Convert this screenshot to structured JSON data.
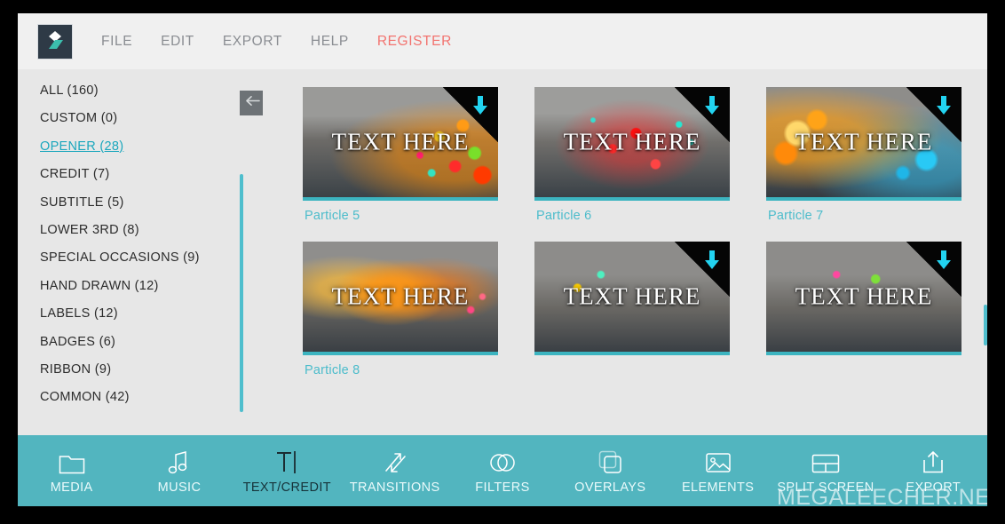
{
  "app": {
    "logo_icon": "filmora-logo-icon",
    "menu": [
      {
        "label": "FILE",
        "accent": false
      },
      {
        "label": "EDIT",
        "accent": false
      },
      {
        "label": "EXPORT",
        "accent": false
      },
      {
        "label": "HELP",
        "accent": false
      },
      {
        "label": "REGISTER",
        "accent": true
      }
    ]
  },
  "sidebar": {
    "collapse_icon": "arrow-left-icon",
    "categories": [
      {
        "label": "ALL (160)",
        "active": false
      },
      {
        "label": "CUSTOM (0)",
        "active": false
      },
      {
        "label": "OPENER (28)",
        "active": true
      },
      {
        "label": "CREDIT (7)",
        "active": false
      },
      {
        "label": "SUBTITLE (5)",
        "active": false
      },
      {
        "label": "LOWER 3RD (8)",
        "active": false
      },
      {
        "label": "SPECIAL OCCASIONS (9)",
        "active": false
      },
      {
        "label": "HAND DRAWN (12)",
        "active": false
      },
      {
        "label": "LABELS (12)",
        "active": false
      },
      {
        "label": "BADGES (6)",
        "active": false
      },
      {
        "label": "RIBBON (9)",
        "active": false
      },
      {
        "label": "COMMON (42)",
        "active": false
      }
    ]
  },
  "grid": {
    "preview_text": "TEXT HERE",
    "download_icon": "download-arrow-icon",
    "items": [
      {
        "label": "Particle 5",
        "downloadable": true,
        "style": "p5"
      },
      {
        "label": "Particle 6",
        "downloadable": true,
        "style": "p6"
      },
      {
        "label": "Particle 7",
        "downloadable": true,
        "style": "p7"
      },
      {
        "label": "Particle 8",
        "downloadable": false,
        "style": "p8"
      },
      {
        "label": "",
        "downloadable": true,
        "style": "p9"
      },
      {
        "label": "",
        "downloadable": true,
        "style": "p10"
      }
    ]
  },
  "toolbar": {
    "items": [
      {
        "label": "MEDIA",
        "icon": "folder-icon",
        "active": false
      },
      {
        "label": "MUSIC",
        "icon": "music-note-icon",
        "active": false
      },
      {
        "label": "TEXT/CREDIT",
        "icon": "text-cursor-icon",
        "active": true
      },
      {
        "label": "TRANSITIONS",
        "icon": "transitions-icon",
        "active": false
      },
      {
        "label": "FILTERS",
        "icon": "filters-icon",
        "active": false
      },
      {
        "label": "OVERLAYS",
        "icon": "overlays-icon",
        "active": false
      },
      {
        "label": "ELEMENTS",
        "icon": "image-icon",
        "active": false
      },
      {
        "label": "SPLIT SCREEN",
        "icon": "split-screen-icon",
        "active": false
      },
      {
        "label": "EXPORT",
        "icon": "export-icon",
        "active": false
      }
    ]
  },
  "watermark": {
    "text": "MEGALEECHER.NET"
  },
  "colors": {
    "accent_teal": "#52b5bf",
    "link_teal": "#4cbccb",
    "register_red": "#f2736f",
    "download_cyan": "#22d3f0"
  }
}
